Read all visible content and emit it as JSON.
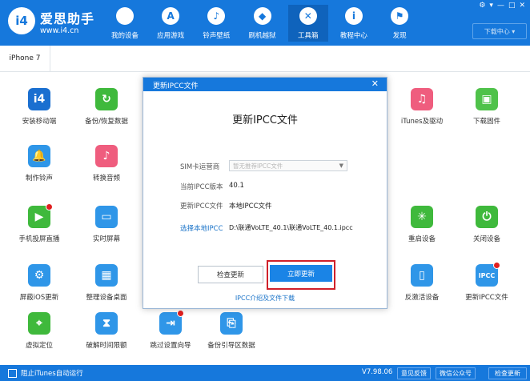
{
  "app": {
    "title": "爱思助手",
    "url": "www.i4.cn",
    "logo_text": "i4"
  },
  "nav": [
    {
      "label": "我的设备",
      "icon": "apple-icon",
      "glyph": ""
    },
    {
      "label": "应用游戏",
      "icon": "app-store-icon",
      "glyph": "A"
    },
    {
      "label": "铃声壁纸",
      "icon": "ringtone-wallpaper-icon",
      "glyph": "♪"
    },
    {
      "label": "刷机越狱",
      "icon": "dropbox-icon",
      "glyph": "◆"
    },
    {
      "label": "工具箱",
      "icon": "toolbox-icon",
      "glyph": "✕"
    },
    {
      "label": "教程中心",
      "icon": "info-icon",
      "glyph": "i"
    },
    {
      "label": "发现",
      "icon": "flag-icon",
      "glyph": "⚑"
    }
  ],
  "window_controls": [
    "⚙",
    "▾",
    "—",
    "□",
    "✕"
  ],
  "download_center": "下载中心 ▾",
  "device_tab": "iPhone 7",
  "tools": [
    {
      "label": "安装移动端",
      "color": "#1a6fd0",
      "glyph": "i4",
      "dot": false,
      "col": 0,
      "row": 0
    },
    {
      "label": "备份/恢复数据",
      "color": "#3fb93c",
      "glyph": "↻",
      "dot": false,
      "col": 1,
      "row": 0
    },
    {
      "label": "iTunes及驱动",
      "color": "#ef5d7e",
      "glyph": "♫",
      "dot": false,
      "col": 6,
      "row": 0
    },
    {
      "label": "下载固件",
      "color": "#4fc24a",
      "glyph": "▣",
      "dot": false,
      "col": 7,
      "row": 0
    },
    {
      "label": "制作铃声",
      "color": "#2f96e8",
      "glyph": "🔔",
      "dot": false,
      "col": 0,
      "row": 1
    },
    {
      "label": "转换音频",
      "color": "#ef5d7e",
      "glyph": "♪",
      "dot": false,
      "col": 1,
      "row": 1
    },
    {
      "label": "手机投屏直播",
      "color": "#3fb93c",
      "glyph": "▶",
      "dot": true,
      "col": 0,
      "row": 2
    },
    {
      "label": "实时屏幕",
      "color": "#2f96e8",
      "glyph": "▭",
      "dot": false,
      "col": 1,
      "row": 2
    },
    {
      "label": "重启设备",
      "color": "#3fb93c",
      "glyph": "✳",
      "dot": false,
      "col": 6,
      "row": 2
    },
    {
      "label": "关闭设备",
      "color": "#3fb93c",
      "glyph": "⏻",
      "dot": false,
      "col": 7,
      "row": 2
    },
    {
      "label": "屏蔽iOS更新",
      "color": "#2f96e8",
      "glyph": "⚙",
      "dot": false,
      "col": 0,
      "row": 3
    },
    {
      "label": "整理设备桌面",
      "color": "#2f96e8",
      "glyph": "▦",
      "dot": false,
      "col": 1,
      "row": 3
    },
    {
      "label": "反激活设备",
      "color": "#2f96e8",
      "glyph": "▯",
      "dot": false,
      "col": 6,
      "row": 3
    },
    {
      "label": "更新IPCC文件",
      "color": "#2f96e8",
      "glyph": "IPCC",
      "dot": true,
      "col": 7,
      "row": 3
    },
    {
      "label": "虚拟定位",
      "color": "#3fb93c",
      "glyph": "⌖",
      "dot": false,
      "col": 0,
      "row": 4
    },
    {
      "label": "破解时间限额",
      "color": "#2f96e8",
      "glyph": "⧗",
      "dot": false,
      "col": 1,
      "row": 4
    },
    {
      "label": "跳过设置向导",
      "color": "#2f96e8",
      "glyph": "⇥",
      "dot": true,
      "col": 2,
      "row": 4
    },
    {
      "label": "备份引导区数据",
      "color": "#2f96e8",
      "glyph": "⎘",
      "dot": false,
      "col": 3,
      "row": 4
    }
  ],
  "status": {
    "itunes_autorun": "阻止iTunes自动运行",
    "version": "V7.98.06",
    "feedback": "意见反馈",
    "wechat": "微信公众号",
    "check_update": "检查更新"
  },
  "modal": {
    "header_title": "更新IPCC文件",
    "close": "✕",
    "title": "更新IPCC文件",
    "carrier_label": "SIM卡运营商",
    "carrier_placeholder": "暂无推荐IPCC文件",
    "current_version_label": "当前IPCC版本",
    "current_version": "40.1",
    "update_file_label": "更新IPCC文件",
    "update_file_value": "本地IPCC文件",
    "choose_local_link": "选择本地IPCC",
    "local_path": "D:\\联通VoLTE_40.1\\联通VoLTE_40.1.ipcc",
    "check_button": "检查更新",
    "update_button": "立即更新",
    "footer_link": "IPCC介绍及文件下载"
  }
}
